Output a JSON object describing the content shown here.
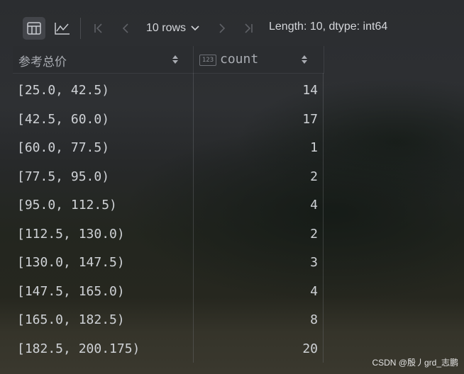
{
  "toolbar": {
    "table_view_icon": "table-icon",
    "chart_view_icon": "line-chart-icon",
    "rows_label": "10 rows",
    "length_info": "Length: 10, dtype: int64"
  },
  "table": {
    "index_header": "参考总价",
    "count_header": "count",
    "type_badge": "123",
    "rows": [
      {
        "index": "[25.0, 42.5)",
        "count": "14"
      },
      {
        "index": "[42.5, 60.0)",
        "count": "17"
      },
      {
        "index": "[60.0, 77.5)",
        "count": "1"
      },
      {
        "index": "[77.5, 95.0)",
        "count": "2"
      },
      {
        "index": "[95.0, 112.5)",
        "count": "4"
      },
      {
        "index": "[112.5, 130.0)",
        "count": "2"
      },
      {
        "index": "[130.0, 147.5)",
        "count": "3"
      },
      {
        "index": "[147.5, 165.0)",
        "count": "4"
      },
      {
        "index": "[165.0, 182.5)",
        "count": "8"
      },
      {
        "index": "[182.5, 200.175)",
        "count": "20"
      }
    ]
  },
  "watermark": "CSDN @殷丿grd_志鹏"
}
